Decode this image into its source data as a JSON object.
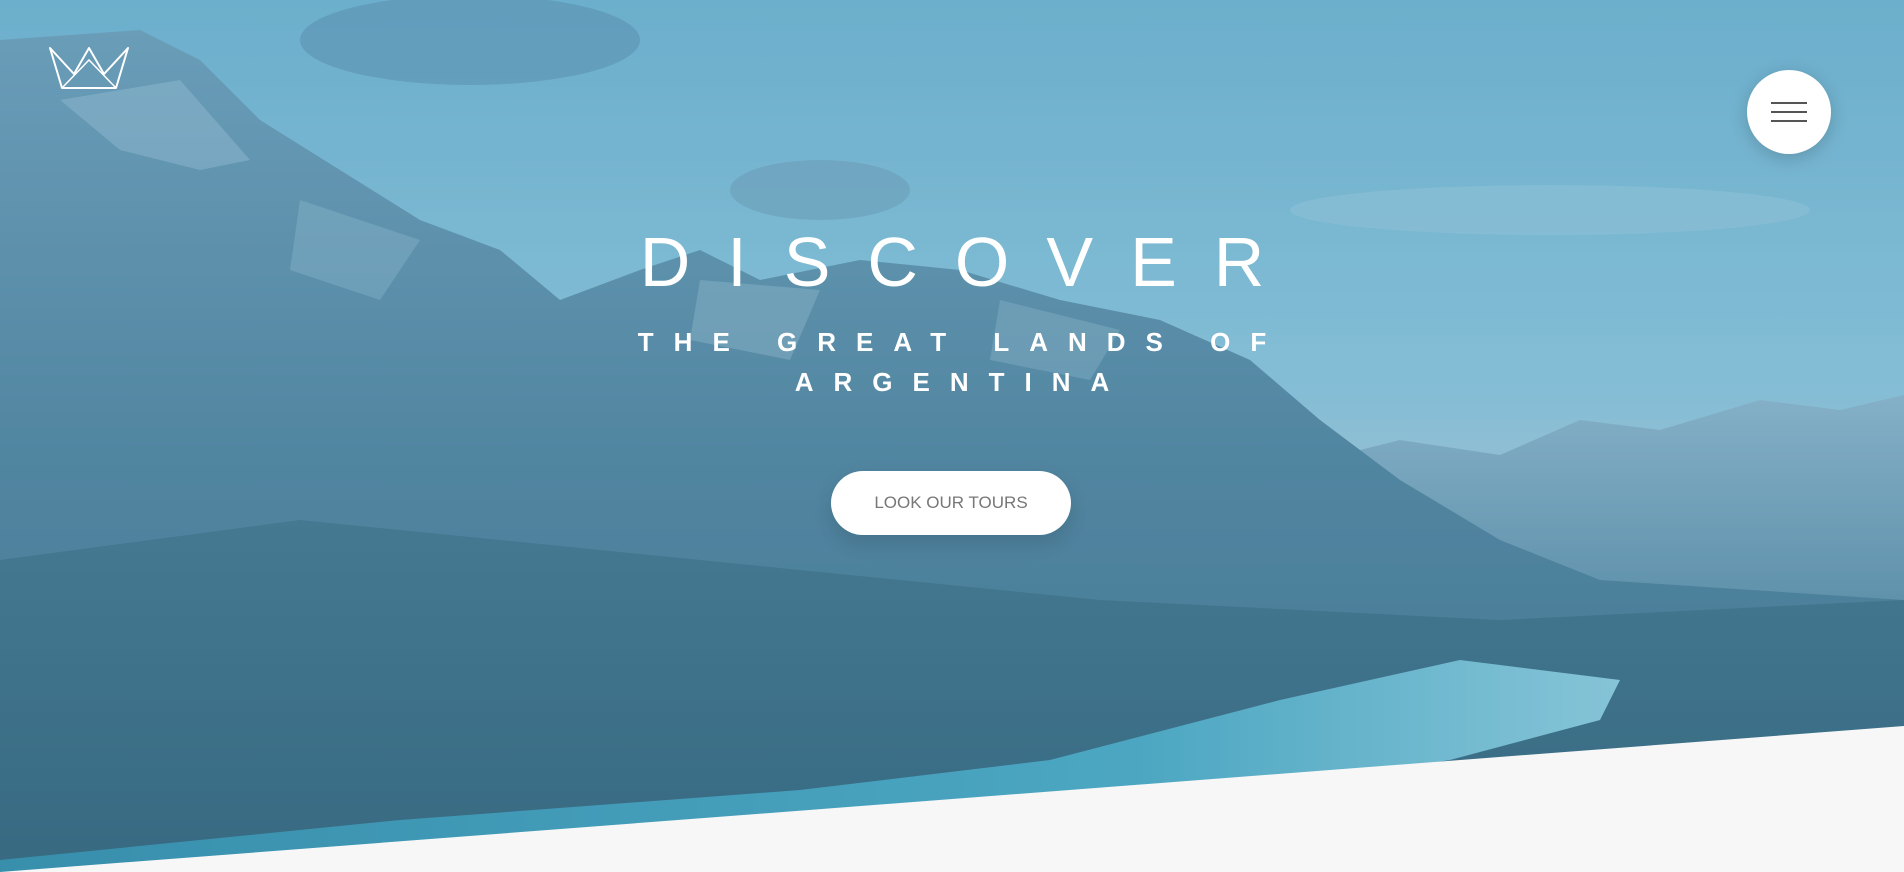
{
  "hero": {
    "title": "DISCOVER",
    "subtitle": "THE GREAT LANDS OF ARGENTINA",
    "cta_label": "LOOK OUR TOURS"
  },
  "header": {
    "logo_icon": "crown-icon",
    "menu_icon": "hamburger-menu-icon"
  },
  "colors": {
    "text": "#ffffff",
    "button_bg": "#ffffff",
    "button_text": "#777777",
    "section_bg": "#f7f7f7",
    "overlay": "#5fa6c4"
  }
}
